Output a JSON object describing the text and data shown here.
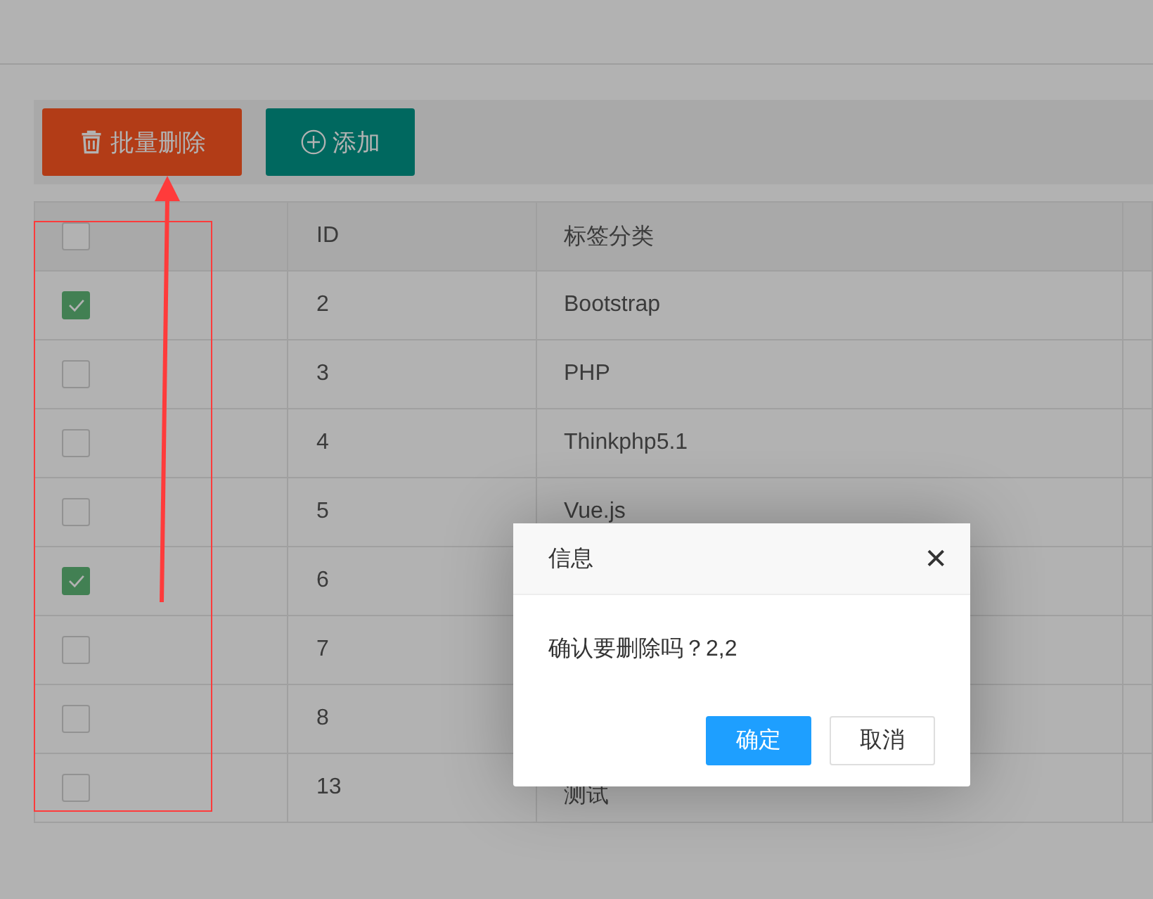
{
  "toolbar": {
    "buttons": [
      {
        "label": "批量删除",
        "kind": "delete"
      },
      {
        "label": "添加",
        "kind": "add"
      }
    ]
  },
  "table": {
    "columns": [
      "ID",
      "标签分类"
    ],
    "header_checked": false,
    "rows": [
      {
        "checked": true,
        "id": "2",
        "name": "Bootstrap"
      },
      {
        "checked": false,
        "id": "3",
        "name": "PHP"
      },
      {
        "checked": false,
        "id": "4",
        "name": "Thinkphp5.1"
      },
      {
        "checked": false,
        "id": "5",
        "name": "Vue.js"
      },
      {
        "checked": true,
        "id": "6"
      },
      {
        "checked": false,
        "id": "7"
      },
      {
        "checked": false,
        "id": "8"
      },
      {
        "checked": false,
        "id": "13",
        "name": "测试"
      }
    ]
  },
  "dialog": {
    "title": "信息",
    "close": "✕",
    "message": "确认要删除吗？2,2",
    "confirm": "确定",
    "cancel": "取消"
  }
}
